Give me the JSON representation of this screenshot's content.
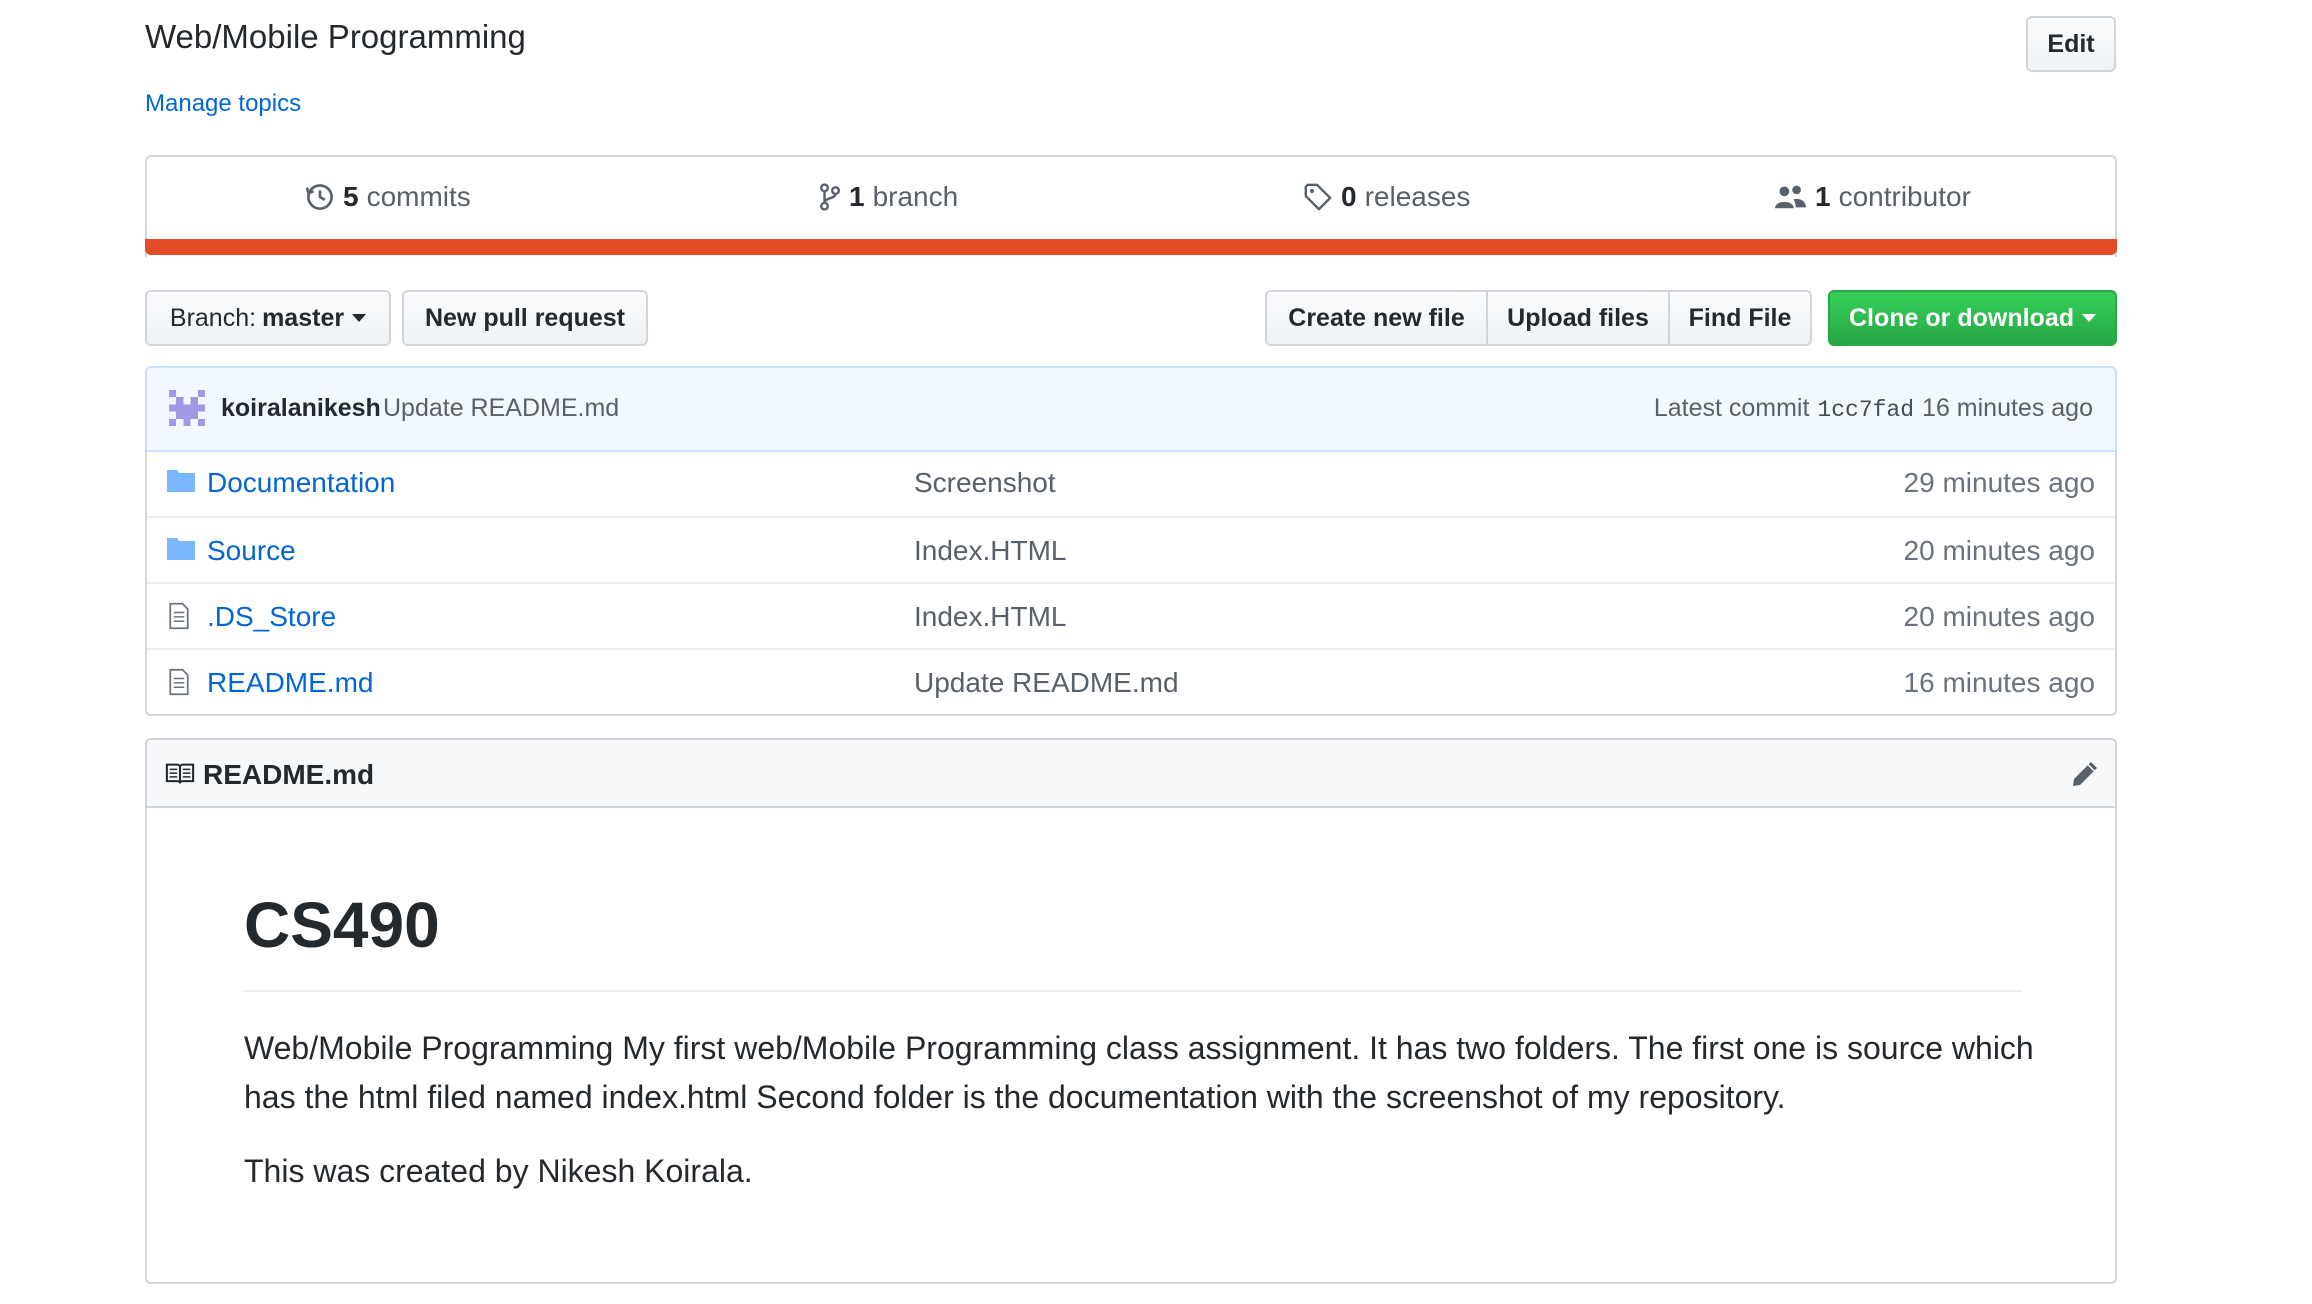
{
  "repo": {
    "description": "Web/Mobile Programming",
    "manage_topics": "Manage topics",
    "edit_label": "Edit"
  },
  "summary": {
    "commits_count": "5",
    "commits_label": "commits",
    "branches_count": "1",
    "branches_label": "branch",
    "releases_count": "0",
    "releases_label": "releases",
    "contributors_count": "1",
    "contributors_label": "contributor",
    "language_bar_color": "#e34c26"
  },
  "toolbar": {
    "branch_prefix": "Branch:",
    "branch_value": "master",
    "new_pull_request": "New pull request",
    "create_new_file": "Create new file",
    "upload_files": "Upload files",
    "find_file": "Find File",
    "clone_or_download": "Clone or download"
  },
  "commit": {
    "author": "koiralanikesh",
    "message": "Update README.md",
    "latest_label": "Latest commit",
    "sha": "1cc7fad",
    "age": "16 minutes ago"
  },
  "files": [
    {
      "icon": "folder-icon",
      "name": "Documentation",
      "message": "Screenshot",
      "age": "29 minutes ago"
    },
    {
      "icon": "folder-icon",
      "name": "Source",
      "message": "Index.HTML",
      "age": "20 minutes ago"
    },
    {
      "icon": "file-icon",
      "name": ".DS_Store",
      "message": "Index.HTML",
      "age": "20 minutes ago"
    },
    {
      "icon": "file-icon",
      "name": "README.md",
      "message": "Update README.md",
      "age": "16 minutes ago"
    }
  ],
  "readme": {
    "title": "README.md",
    "heading": "CS490",
    "paragraph1": "Web/Mobile Programming My first web/Mobile Programming class assignment. It has two folders. The first one is source which has the html filed named index.html Second folder is the documentation with the screenshot of my repository.",
    "paragraph2": "This was created by Nikesh Koirala."
  },
  "colors": {
    "link": "#0366d6",
    "clone_green": "#28a745",
    "folder_icon": "#79b8ff",
    "commit_bg": "#f1f8ff"
  }
}
